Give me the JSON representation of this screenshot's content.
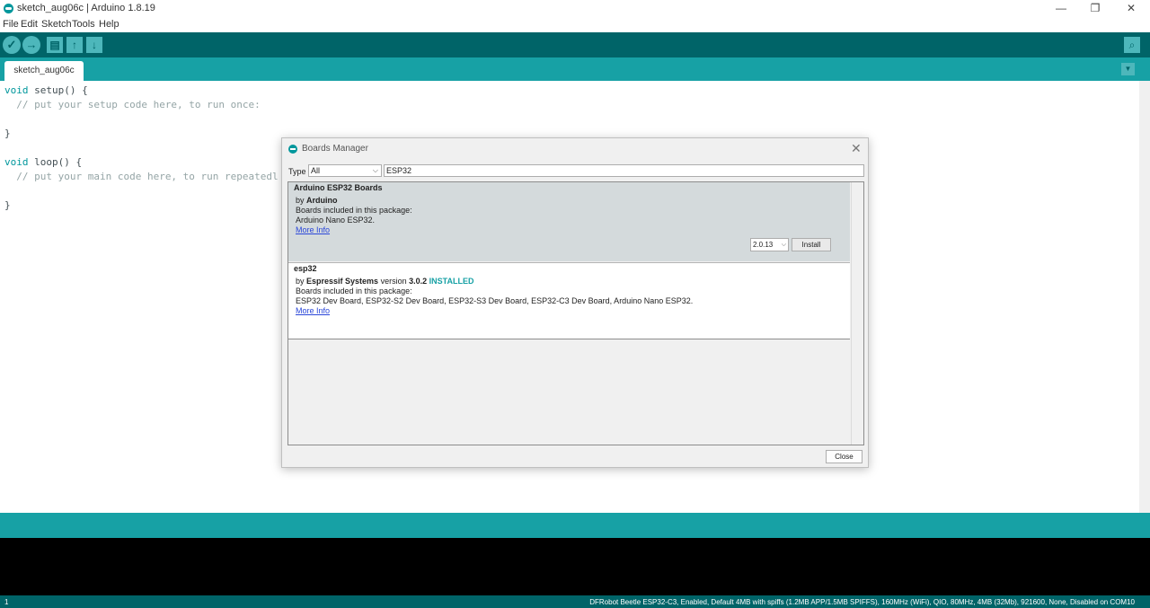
{
  "window": {
    "title": "sketch_aug06c | Arduino 1.8.19",
    "minimize": "—",
    "restore": "❐",
    "close": "✕"
  },
  "menu": [
    "File",
    "Edit",
    "Sketch",
    "Tools",
    "Help"
  ],
  "toolbar": {
    "verify_icon": "✓",
    "upload_icon": "→",
    "new_icon": "▤",
    "open_icon": "↑",
    "save_icon": "↓",
    "serial_icon": "⌕",
    "tab_menu_icon": "▼"
  },
  "tab": {
    "label": "sketch_aug06c"
  },
  "code": [
    {
      "kw": "void",
      "rest": " setup() {"
    },
    {
      "kw": "",
      "rest": "  ",
      "cm": "// put your setup code here, to run once:"
    },
    {
      "kw": "",
      "rest": ""
    },
    {
      "kw": "",
      "rest": "}"
    },
    {
      "kw": "",
      "rest": ""
    },
    {
      "kw": "void",
      "rest": " loop() {"
    },
    {
      "kw": "",
      "rest": "  ",
      "cm": "// put your main code here, to run repeatedl"
    },
    {
      "kw": "",
      "rest": ""
    },
    {
      "kw": "",
      "rest": "}"
    }
  ],
  "dialog": {
    "title": "Boards Manager",
    "close_icon": "✕",
    "type_label": "Type",
    "type_value": "All",
    "filter_value": "ESP32",
    "packages": [
      {
        "name": "Arduino ESP32 Boards",
        "by_prefix": "by ",
        "author": "Arduino",
        "included_label": "Boards included in this package:",
        "boards": "Arduino Nano ESP32.",
        "more_info": "More Info",
        "version_select": "2.0.13",
        "install_label": "Install"
      },
      {
        "name": "esp32",
        "by_prefix": "by ",
        "author": "Espressif Systems",
        "version_prefix": " version ",
        "version": "3.0.2",
        "installed": "INSTALLED",
        "included_label": "Boards included in this package:",
        "boards": "ESP32 Dev Board, ESP32-S2 Dev Board, ESP32-S3 Dev Board, ESP32-C3 Dev Board, Arduino Nano ESP32.",
        "more_info": "More Info"
      }
    ],
    "close_button": "Close"
  },
  "status": {
    "line": "1",
    "board": "DFRobot Beetle ESP32-C3, Enabled, Default 4MB with spiffs (1.2MB APP/1.5MB SPIFFS), 160MHz (WiFi), QIO, 80MHz, 4MB (32Mb), 921600, None, Disabled on COM10"
  },
  "colors": {
    "toolbar": "#006468",
    "tabstrip": "#17a1a5",
    "accent": "#00979c"
  }
}
